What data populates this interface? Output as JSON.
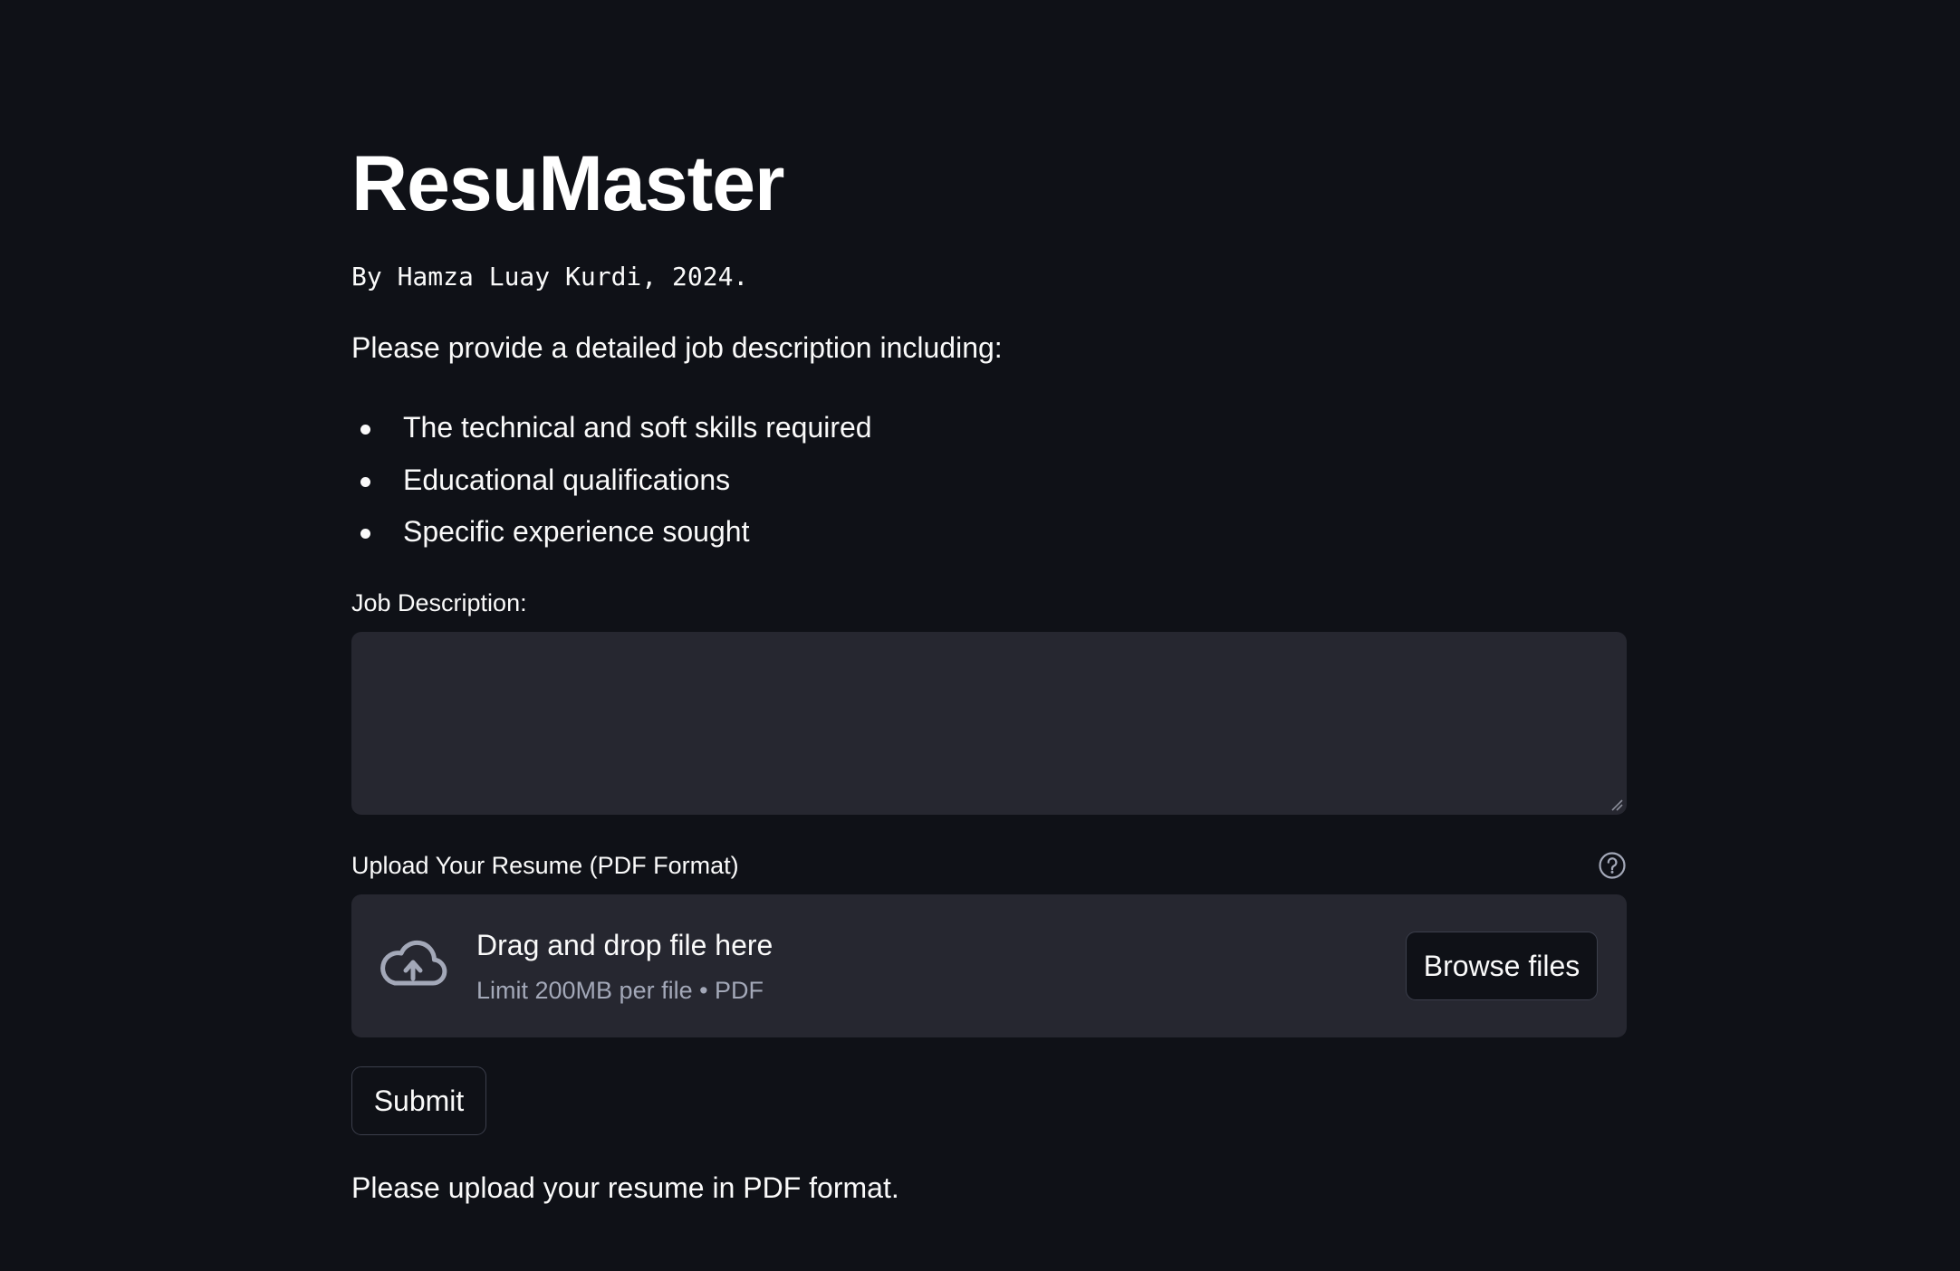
{
  "header": {
    "title": "ResuMaster",
    "byline": "By Hamza Luay Kurdi, 2024."
  },
  "intro": {
    "text": "Please provide a detailed job description including:",
    "bullets": [
      "The technical and soft skills required",
      "Educational qualifications",
      "Specific experience sought"
    ]
  },
  "job_description": {
    "label": "Job Description:",
    "value": "",
    "placeholder": ""
  },
  "upload": {
    "label": "Upload Your Resume (PDF Format)",
    "help_icon": "question-circle-icon",
    "upload_icon": "cloud-upload-icon",
    "drop_title": "Drag and drop file here",
    "drop_limit": "Limit 200MB per file • PDF",
    "browse_label": "Browse files"
  },
  "actions": {
    "submit_label": "Submit"
  },
  "status": {
    "message": "Please upload your resume in PDF format."
  },
  "colors": {
    "background": "#0f1117",
    "input_background": "#262730",
    "text": "#fafafa",
    "muted_text": "#a3a8b8",
    "button_border": "#3c3f4c"
  }
}
